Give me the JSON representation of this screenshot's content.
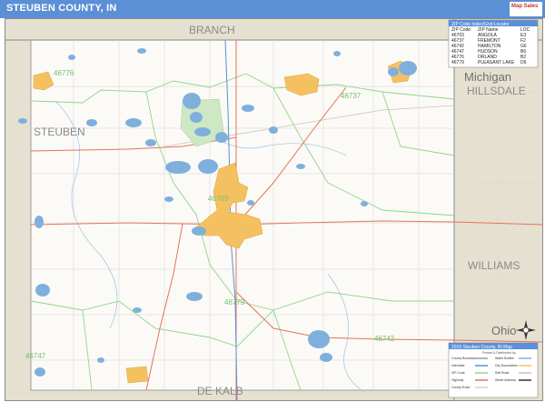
{
  "map_title": "STEUBEN COUNTY, IN",
  "publisher_mark": "Map Sales",
  "zip_index": {
    "heading": "ZIP Code Index/Grid Locator",
    "columns": [
      "ZIP Code",
      "ZIP Name",
      "LOC"
    ],
    "rows": [
      [
        "46703",
        "ANGOLA",
        "E3"
      ],
      [
        "46737",
        "FREMONT",
        "F2"
      ],
      [
        "46742",
        "HAMILTON",
        "G6"
      ],
      [
        "46747",
        "HUDSON",
        "B6"
      ],
      [
        "46776",
        "ORLAND",
        "B2"
      ],
      [
        "46779",
        "PLEASANT LAKE",
        "D6"
      ]
    ]
  },
  "labels": {
    "county_branch": "BRANCH",
    "county_steuben": "STEUBEN",
    "state_michigan": "Michigan",
    "county_hillsdale": "HILLSDALE",
    "county_williams": "WILLIAMS",
    "state_ohio": "Ohio",
    "county_dekalb": "DE KALB",
    "zip_46776": "46776",
    "zip_46737": "46737",
    "zip_46703": "46703",
    "zip_46779": "46779",
    "zip_46742": "46742",
    "zip_46747": "46747"
  },
  "legend": {
    "title": "2016 Steuben County, IN Map",
    "subtitle": "Printed & Distributed by",
    "items": [
      "County Boundary",
      "Interstate",
      "ZIP Code",
      "Highway",
      "County Road",
      "Water Bodies",
      "City Boundaries",
      "Rail Road",
      "Street Address"
    ]
  },
  "colors": {
    "title_bar": "#5b8fd6",
    "city": "#f5c160",
    "water": "#7fb0dd",
    "neighbor_land": "#e6e0d0",
    "zip_boundary": "#8fd68f",
    "highway": "#e6735a"
  }
}
